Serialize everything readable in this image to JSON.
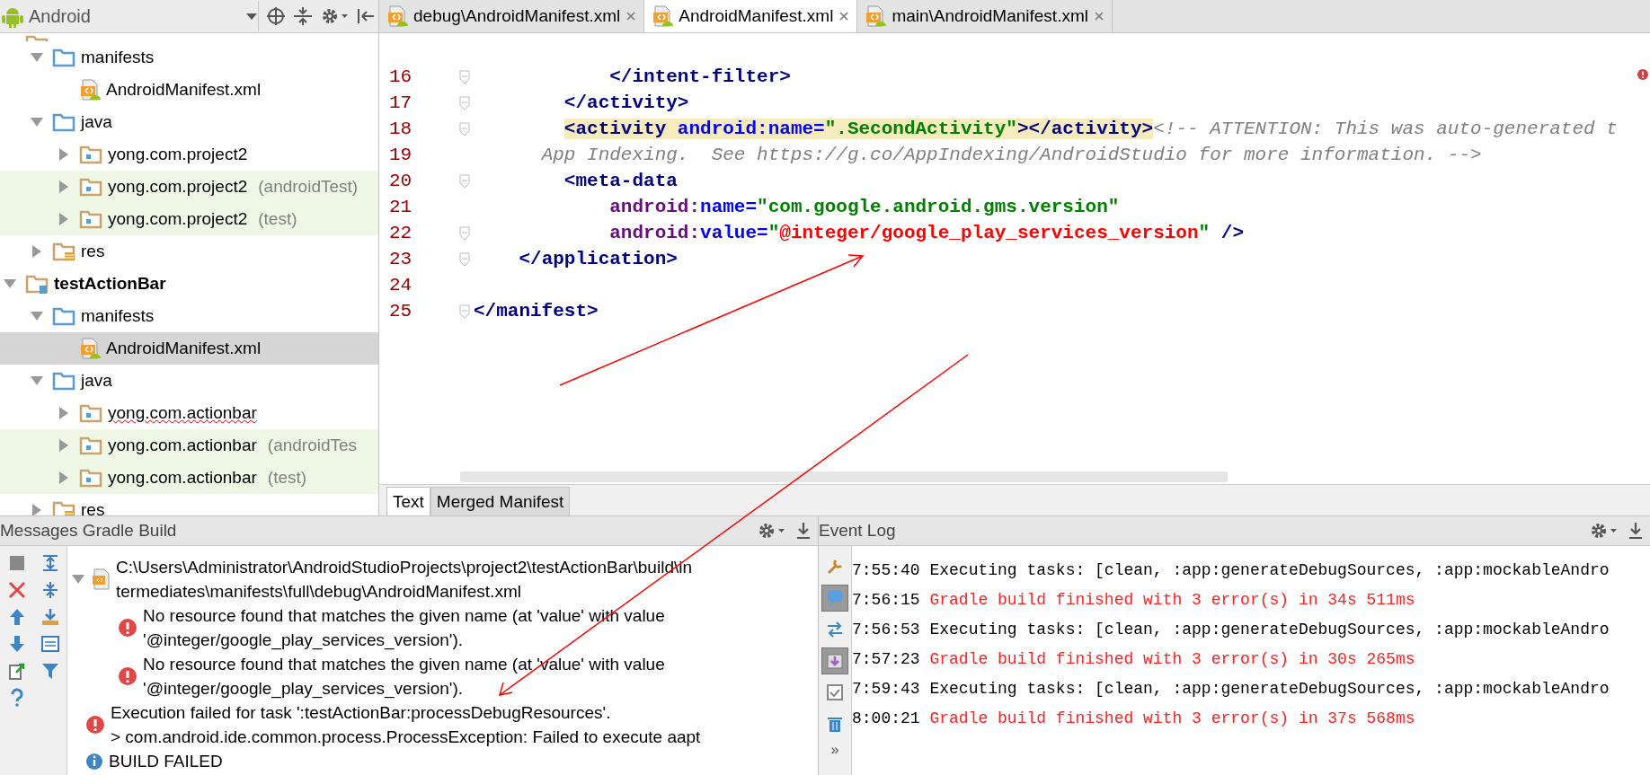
{
  "project_panel": {
    "view_selector": "Android",
    "tree": [
      {
        "kind": "module",
        "expanded": true,
        "selected": false,
        "children": [
          {
            "label": "manifests",
            "kind": "folder",
            "expanded": true,
            "selected": false,
            "children": [
              {
                "label": "AndroidManifest.xml",
                "kind": "manifest-file",
                "selected": false
              }
            ]
          },
          {
            "label": "java",
            "kind": "folder",
            "expanded": true,
            "selected": false,
            "children": [
              {
                "label": "yong.com.project2",
                "kind": "package",
                "expanded": false,
                "selected": false
              },
              {
                "label": "yong.com.project2",
                "suffix": "(androidTest)",
                "kind": "package",
                "expanded": false,
                "selected": false,
                "test_source": true
              },
              {
                "label": "yong.com.project2",
                "suffix": "(test)",
                "kind": "package",
                "expanded": false,
                "selected": false,
                "test_source": true
              }
            ]
          },
          {
            "label": "res",
            "kind": "res",
            "expanded": false,
            "selected": false
          }
        ]
      },
      {
        "label": "testActionBar",
        "kind": "module",
        "expanded": true,
        "selected": false,
        "children": [
          {
            "label": "manifests",
            "kind": "folder",
            "expanded": true,
            "selected": false,
            "children": [
              {
                "label": "AndroidManifest.xml",
                "kind": "manifest-file",
                "selected": true
              }
            ]
          },
          {
            "label": "java",
            "kind": "folder",
            "expanded": true,
            "selected": false,
            "children": [
              {
                "label": "yong.com.actionbar",
                "kind": "package",
                "expanded": false,
                "selected": false,
                "spell_error": true
              },
              {
                "label": "yong.com.actionbar",
                "suffix": "(androidTes",
                "kind": "package",
                "expanded": false,
                "selected": false,
                "test_source": true
              },
              {
                "label": "yong.com.actionbar",
                "suffix": "(test)",
                "kind": "package",
                "expanded": false,
                "selected": false,
                "test_source": true
              }
            ]
          },
          {
            "label": "res",
            "kind": "res",
            "expanded": false,
            "selected": false
          }
        ]
      }
    ]
  },
  "editor": {
    "tabs": [
      {
        "label": "debug\\AndroidManifest.xml",
        "selected": false
      },
      {
        "label": "AndroidManifest.xml",
        "selected": true
      },
      {
        "label": "main\\AndroidManifest.xml",
        "selected": false
      }
    ],
    "lines": [
      {
        "number": "16",
        "fold_marker": true,
        "tokens": [
          {
            "kind": "tag",
            "text": "            </intent-filter>"
          }
        ]
      },
      {
        "number": "17",
        "fold_marker": true,
        "tokens": [
          {
            "kind": "tag",
            "text": "        </activity>"
          }
        ]
      },
      {
        "number": "18",
        "fold_marker": true,
        "tokens": [
          {
            "kind": "tag",
            "text": "        <activity ",
            "highlighted": true
          },
          {
            "kind": "attr",
            "text": "android:name=",
            "highlighted": true
          },
          {
            "kind": "string",
            "text": "\".SecondActivity\"",
            "highlighted": true
          },
          {
            "kind": "tag",
            "text": "></activity>",
            "highlighted": true
          },
          {
            "kind": "comment",
            "text": "<!-- ATTENTION: This was auto-generated t"
          }
        ]
      },
      {
        "number": "19",
        "fold_marker": false,
        "tokens": [
          {
            "kind": "comment",
            "text": "      App Indexing.  See https://g.co/AppIndexing/AndroidStudio for more information. -->"
          }
        ]
      },
      {
        "number": "20",
        "fold_marker": true,
        "tokens": [
          {
            "kind": "tag",
            "text": "        <meta-data"
          }
        ]
      },
      {
        "number": "21",
        "fold_marker": false,
        "tokens": [
          {
            "kind": "attr-ns",
            "text": "            android:"
          },
          {
            "kind": "attr",
            "text": "name="
          },
          {
            "kind": "string",
            "text": "\"com.google.android.gms.version\""
          }
        ]
      },
      {
        "number": "22",
        "fold_marker": true,
        "tokens": [
          {
            "kind": "attr-ns",
            "text": "            android:"
          },
          {
            "kind": "attr",
            "text": "value="
          },
          {
            "kind": "string",
            "text": "\""
          },
          {
            "kind": "string-error",
            "text": "@integer/google_play_services_version"
          },
          {
            "kind": "string",
            "text": "\""
          },
          {
            "kind": "tag",
            "text": " />"
          }
        ]
      },
      {
        "number": "23",
        "fold_marker": true,
        "tokens": [
          {
            "kind": "tag",
            "text": "    </application>"
          }
        ]
      },
      {
        "number": "24",
        "fold_marker": false
      },
      {
        "number": "25",
        "fold_marker": true,
        "tokens": [
          {
            "kind": "tag",
            "text": "</manifest>"
          }
        ]
      }
    ],
    "bottom_tabs": [
      {
        "label": "Text",
        "selected": true
      },
      {
        "label": "Merged Manifest",
        "selected": false
      }
    ]
  },
  "messages_panel": {
    "title": "Messages",
    "tab": "Gradle Build",
    "items": [
      {
        "kind": "file",
        "expanded": true,
        "lines": [
          "C:\\Users\\Administrator\\AndroidStudioProjects\\project2\\testActionBar\\build\\in",
          "termediates\\manifests\\full\\debug\\AndroidManifest.xml"
        ],
        "children": [
          {
            "kind": "error",
            "lines": [
              "No resource found that matches the given name (at 'value' with value",
              "'@integer/google_play_services_version')."
            ]
          },
          {
            "kind": "error",
            "lines": [
              "No resource found that matches the given name (at 'value' with value",
              "'@integer/google_play_services_version')."
            ]
          }
        ]
      },
      {
        "kind": "error",
        "lines": [
          "Execution failed for task ':testActionBar:processDebugResources'.",
          "> com.android.ide.common.process.ProcessException: Failed to execute aapt"
        ]
      },
      {
        "kind": "info",
        "lines": [
          "BUILD FAILED"
        ]
      }
    ]
  },
  "event_log": {
    "title": "Event Log",
    "expand_label": "»",
    "entries": [
      {
        "time": "7:55:40",
        "text": "Executing tasks: [clean, :app:generateDebugSources, :app:mockableAndro",
        "kind": "info"
      },
      {
        "time": "7:56:15",
        "text": "Gradle build finished with 3 error(s) in 34s 511ms",
        "kind": "error"
      },
      {
        "time": "7:56:53",
        "text": "Executing tasks: [clean, :app:generateDebugSources, :app:mockableAndro",
        "kind": "info"
      },
      {
        "time": "7:57:23",
        "text": "Gradle build finished with 3 error(s) in 30s 265ms",
        "kind": "error"
      },
      {
        "time": "7:59:43",
        "text": "Executing tasks: [clean, :app:generateDebugSources, :app:mockableAndro",
        "kind": "info"
      },
      {
        "time": "8:00:21",
        "text": "Gradle build finished with 3 error(s) in 37s 568ms",
        "kind": "error"
      }
    ]
  }
}
